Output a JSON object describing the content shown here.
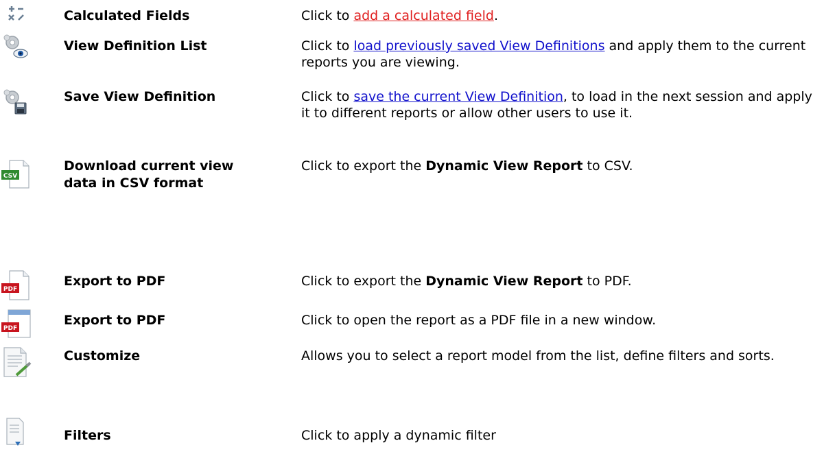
{
  "rows": [
    {
      "icon": "calculator-icon",
      "label": "Calculated Fields",
      "desc_prefix": "Click to ",
      "desc_link": "add a calculated field",
      "desc_suffix": "."
    },
    {
      "icon": "gear-eye-icon",
      "label": "View Definition List",
      "desc_prefix": "Click to ",
      "desc_link": "load previously saved View Definitions",
      "desc_suffix": " and apply them to the current reports you are viewing."
    },
    {
      "icon": "gear-floppy-icon",
      "label": "Save View Definition",
      "desc_prefix": "Click to ",
      "desc_link": "save the current View Definition",
      "desc_suffix": ", to load in the next session and apply it to different reports or allow other users to use it."
    },
    {
      "icon": "csv-file-icon",
      "label": "Download current view data in CSV format",
      "desc_prefix": "Click to export the ",
      "desc_bold": "Dynamic View Report",
      "desc_suffix": " to CSV."
    },
    {
      "icon": "pdf-file-icon",
      "label": "Export to PDF",
      "desc_prefix": "Click to export the ",
      "desc_bold": "Dynamic View Report",
      "desc_suffix": " to PDF."
    },
    {
      "icon": "pdf-window-icon",
      "label": "Export to PDF",
      "desc_prefix": "Click to open the report as a PDF file in a new window."
    },
    {
      "icon": "document-pencil-icon",
      "label": "Customize",
      "desc_prefix": "Allows you to select a report model from the list, define filters and sorts."
    },
    {
      "icon": "document-filter-icon",
      "label": "Filters",
      "desc_prefix": "Click to apply a dynamic filter"
    }
  ],
  "icon_badges": {
    "csv": "CSV",
    "pdf": "PDF"
  },
  "colors": {
    "link_blue": "#1111cc",
    "link_red": "#e01f1f",
    "csv_green": "#2f8a2f",
    "pdf_red": "#c8141e"
  }
}
